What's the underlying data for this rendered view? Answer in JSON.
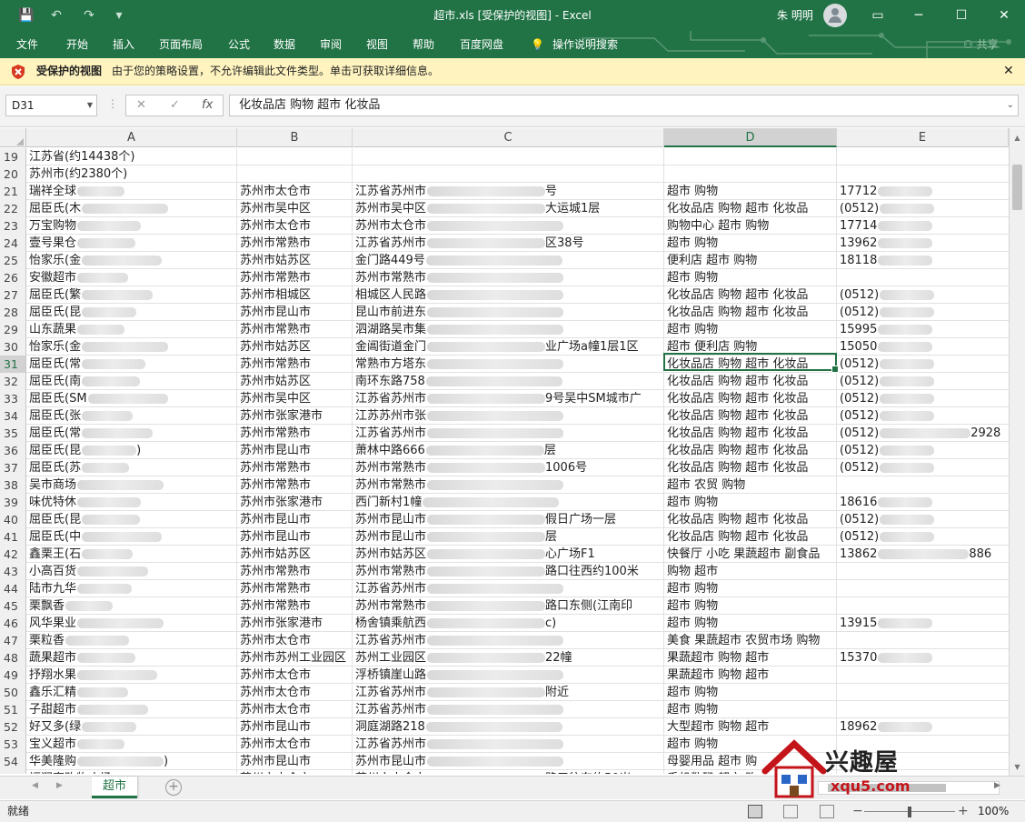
{
  "window": {
    "title": "超市.xls  [受保护的视图]  -  Excel",
    "user": "朱 明明",
    "minimize": "─",
    "maximize": "☐",
    "close": "✕",
    "ribbon_display": "▭"
  },
  "quick_access": {
    "save": "💾",
    "undo": "↶",
    "redo": "↷",
    "customize": "▾"
  },
  "ribbon_tabs": [
    "文件",
    "开始",
    "插入",
    "页面布局",
    "公式",
    "数据",
    "审阅",
    "视图",
    "帮助",
    "百度网盘",
    "操作说明搜索"
  ],
  "share_label": "共享",
  "protected_view": {
    "title": "受保护的视图",
    "message": "由于您的策略设置，不允许编辑此文件类型。单击可获取详细信息。",
    "close": "✕"
  },
  "formula_bar": {
    "name_box": "D31",
    "formula": "化妆品店 购物 超市 化妆品",
    "cancel": "✕",
    "enter": "✓",
    "fx": "fx",
    "dots": "⋮"
  },
  "columns": [
    "A",
    "B",
    "C",
    "D",
    "E"
  ],
  "selected_column": "D",
  "selected_row": "31",
  "rows": [
    {
      "n": "19",
      "a": "江苏省(约14438个)",
      "b": "",
      "c": "",
      "d": "",
      "e": ""
    },
    {
      "n": "20",
      "a": "苏州市(约2380个)",
      "b": "",
      "c": "",
      "d": "",
      "e": ""
    },
    {
      "n": "21",
      "a": "瑞祥全球",
      "b": "苏州市太仓市",
      "c": "江苏省苏州市",
      "c2": "号",
      "d": "超市 购物",
      "e": "17712"
    },
    {
      "n": "22",
      "a": "屈臣氏(木",
      "b": "苏州市吴中区",
      "c": "苏州市吴中区",
      "c2": "大运城1层",
      "d": "化妆品店 购物 超市 化妆品",
      "e": "(0512)"
    },
    {
      "n": "23",
      "a": "万宝购物",
      "b": "苏州市太仓市",
      "c": "苏州市太仓市",
      "c2": "",
      "d": "购物中心 超市 购物",
      "e": "17714"
    },
    {
      "n": "24",
      "a": "壹号果仓",
      "b": "苏州市常熟市",
      "c": "江苏省苏州市",
      "c2": "区38号",
      "d": "超市 购物",
      "e": "13962"
    },
    {
      "n": "25",
      "a": "怡家乐(金",
      "b": "苏州市姑苏区",
      "c": "金门路449号",
      "c2": "",
      "d": "便利店 超市 购物",
      "e": "18118"
    },
    {
      "n": "26",
      "a": "安徽超市",
      "b": "苏州市常熟市",
      "c": "苏州市常熟市",
      "c2": "",
      "d": "超市 购物",
      "e": ""
    },
    {
      "n": "27",
      "a": "屈臣氏(繁",
      "b": "苏州市相城区",
      "c": "相城区人民路",
      "c2": "",
      "d": "化妆品店 购物 超市 化妆品",
      "e": "(0512)"
    },
    {
      "n": "28",
      "a": "屈臣氏(昆",
      "b": "苏州市昆山市",
      "c": "昆山市前进东",
      "c2": "",
      "d": "化妆品店 购物 超市 化妆品",
      "e": "(0512)"
    },
    {
      "n": "29",
      "a": "山东蔬果",
      "b": "苏州市常熟市",
      "c": "泗湖路吴市集",
      "c2": "",
      "d": "超市 购物",
      "e": "15995"
    },
    {
      "n": "30",
      "a": "怡家乐(金",
      "b": "苏州市姑苏区",
      "c": "金阊街道金门",
      "c2": "业广场a幢1层1区",
      "d": "超市 便利店 购物",
      "e": "15050"
    },
    {
      "n": "31",
      "a": "屈臣氏(常",
      "b": "苏州市常熟市",
      "c": "常熟市方塔东",
      "c2": "",
      "d": "化妆品店 购物 超市 化妆品",
      "e": "(0512)"
    },
    {
      "n": "32",
      "a": "屈臣氏(南",
      "b": "苏州市姑苏区",
      "c": "南环东路758",
      "c2": "",
      "d": "化妆品店 购物 超市 化妆品",
      "e": "(0512)"
    },
    {
      "n": "33",
      "a": "屈臣氏(SM",
      "b": "苏州市吴中区",
      "c": "江苏省苏州市",
      "c2": "9号吴中SM城市广",
      "d": "化妆品店 购物 超市 化妆品",
      "e": "(0512)"
    },
    {
      "n": "34",
      "a": "屈臣氏(张",
      "b": "苏州市张家港市",
      "c": "江苏苏州市张",
      "c2": "",
      "d": "化妆品店 购物 超市 化妆品",
      "e": "(0512)"
    },
    {
      "n": "35",
      "a": "屈臣氏(常",
      "b": "苏州市常熟市",
      "c": "江苏省苏州市",
      "c2": "",
      "d": "化妆品店 购物 超市 化妆品",
      "e": "(0512)",
      "e2": "2928"
    },
    {
      "n": "36",
      "a": "屈臣氏(昆",
      "a2": ")",
      "b": "苏州市昆山市",
      "c": "萧林中路666",
      "c2": "层",
      "d": "化妆品店 购物 超市 化妆品",
      "e": "(0512)"
    },
    {
      "n": "37",
      "a": "屈臣氏(苏",
      "b": "苏州市常熟市",
      "c": "苏州市常熟市",
      "c2": "1006号",
      "d": "化妆品店 购物 超市 化妆品",
      "e": "(0512)"
    },
    {
      "n": "38",
      "a": "吴市商场",
      "b": "苏州市常熟市",
      "c": "苏州市常熟市",
      "c2": "",
      "d": "超市 农贸 购物",
      "e": ""
    },
    {
      "n": "39",
      "a": "味优特休",
      "b": "苏州市张家港市",
      "c": "西门新村1幢",
      "c2": "",
      "d": "超市 购物",
      "e": "18616"
    },
    {
      "n": "40",
      "a": "屈臣氏(昆",
      "b": "苏州市昆山市",
      "c": "苏州市昆山市",
      "c2": "假日广场一层",
      "d": "化妆品店 购物 超市 化妆品",
      "e": "(0512)"
    },
    {
      "n": "41",
      "a": "屈臣氏(中",
      "b": "苏州市昆山市",
      "c": "苏州市昆山市",
      "c2": "层",
      "d": "化妆品店 购物 超市 化妆品",
      "e": "(0512)"
    },
    {
      "n": "42",
      "a": "鑫栗王(石",
      "b": "苏州市姑苏区",
      "c": "苏州市姑苏区",
      "c2": "心广场F1",
      "d": "快餐厅 小吃 果蔬超市 副食品",
      "e": "13862",
      "e2": "886"
    },
    {
      "n": "43",
      "a": "小高百货",
      "b": "苏州市常熟市",
      "c": "苏州市常熟市",
      "c2": "路口往西约100米",
      "d": "购物 超市",
      "e": ""
    },
    {
      "n": "44",
      "a": "陆市九华",
      "b": "苏州市常熟市",
      "c": "江苏省苏州市",
      "c2": "",
      "d": "超市 购物",
      "e": ""
    },
    {
      "n": "45",
      "a": "栗飘香",
      "b": "苏州市常熟市",
      "c": "苏州市常熟市",
      "c2": "路口东侧(江南印",
      "d": "超市 购物",
      "e": ""
    },
    {
      "n": "46",
      "a": "风华果业",
      "b": "苏州市张家港市",
      "c": "杨舍镇乘航西",
      "c2": "c)",
      "d": "超市 购物",
      "e": "13915"
    },
    {
      "n": "47",
      "a": "栗粒香",
      "b": "苏州市太仓市",
      "c": "江苏省苏州市",
      "c2": "",
      "d": "美食 果蔬超市 农贸市场 购物",
      "e": ""
    },
    {
      "n": "48",
      "a": "蔬果超市",
      "b": "苏州市苏州工业园区",
      "c": "苏州工业园区",
      "c2": "22幢",
      "d": "果蔬超市 购物 超市",
      "e": "15370"
    },
    {
      "n": "49",
      "a": "抒翔水果",
      "b": "苏州市太仓市",
      "c": "浮桥镇崖山路",
      "c2": "",
      "d": "果蔬超市 购物 超市",
      "e": ""
    },
    {
      "n": "50",
      "a": "鑫乐汇精",
      "b": "苏州市太仓市",
      "c": "江苏省苏州市",
      "c2": "附近",
      "d": "超市 购物",
      "e": ""
    },
    {
      "n": "51",
      "a": "子甜超市",
      "b": "苏州市太仓市",
      "c": "江苏省苏州市",
      "c2": "",
      "d": "超市 购物",
      "e": ""
    },
    {
      "n": "52",
      "a": "好又多(绿",
      "b": "苏州市昆山市",
      "c": "洞庭湖路218",
      "c2": "",
      "d": "大型超市 购物 超市",
      "e": "18962"
    },
    {
      "n": "53",
      "a": "宝义超市",
      "b": "苏州市太仓市",
      "c": "江苏省苏州市",
      "c2": "",
      "d": "超市 购物",
      "e": ""
    },
    {
      "n": "54",
      "a": "华美隆购",
      "a2": ")",
      "b": "苏州市昆山市",
      "c": "苏州市昆山市",
      "c2": "",
      "d": "母婴用品 超市 购",
      "e": ""
    },
    {
      "n": "55",
      "a": "福润家购物广场",
      "b": "苏州市太仓市",
      "c": "苏州市太仓市",
      "c2": "路口往东约50米",
      "d": "手机数码 超市 购",
      "e": ""
    }
  ],
  "sheet_tab": "超市",
  "add_sheet": "+",
  "status": {
    "ready": "就绪",
    "zoom": "100%",
    "zoom_out": "−",
    "zoom_in": "+"
  },
  "watermark": {
    "brand": "兴趣屋",
    "url": "xqu5.com"
  },
  "colors": {
    "accent": "#217346",
    "protected_bar": "#fff4c0",
    "shield": "#d9391e"
  }
}
